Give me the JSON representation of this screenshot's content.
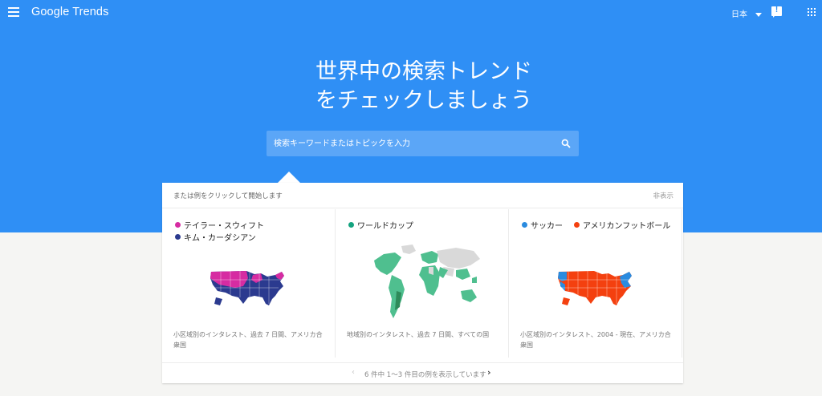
{
  "header": {
    "logo": "Google Trends",
    "language": "日本",
    "feedback_icon": "feedback-icon",
    "apps_icon": "apps-grid-icon",
    "menu_icon": "hamburger-menu-icon"
  },
  "hero": {
    "title_line1": "世界中の検索トレンド",
    "title_line2": "をチェックしましょう",
    "bg_color": "#2f8ff5"
  },
  "search": {
    "placeholder": "検索キーワードまたはトピックを入力",
    "icon": "search-icon"
  },
  "examples": {
    "intro": "または例をクリックして開始します",
    "hide_label": "非表示",
    "cards": [
      {
        "terms": [
          {
            "label": "テイラー・スウィフト",
            "color": "#d62ca2"
          },
          {
            "label": "キム・カーダシアン",
            "color": "#2b3a8f"
          }
        ],
        "caption": "小区域別のインタレスト、過去 7 日間、アメリカ合衆国"
      },
      {
        "terms": [
          {
            "label": "ワールドカップ",
            "color": "#14a37f"
          }
        ],
        "caption": "地域別のインタレスト、過去 7 日間、すべての国"
      },
      {
        "terms": [
          {
            "label": "サッカー",
            "color": "#2a8bdf"
          },
          {
            "label": "アメリカンフットボール",
            "color": "#f4400f"
          }
        ],
        "caption": "小区域別のインタレスト、2004 - 現在、アメリカ合衆国"
      }
    ],
    "pager_text": "6 件中 1〜3 件目の例を表示しています"
  }
}
